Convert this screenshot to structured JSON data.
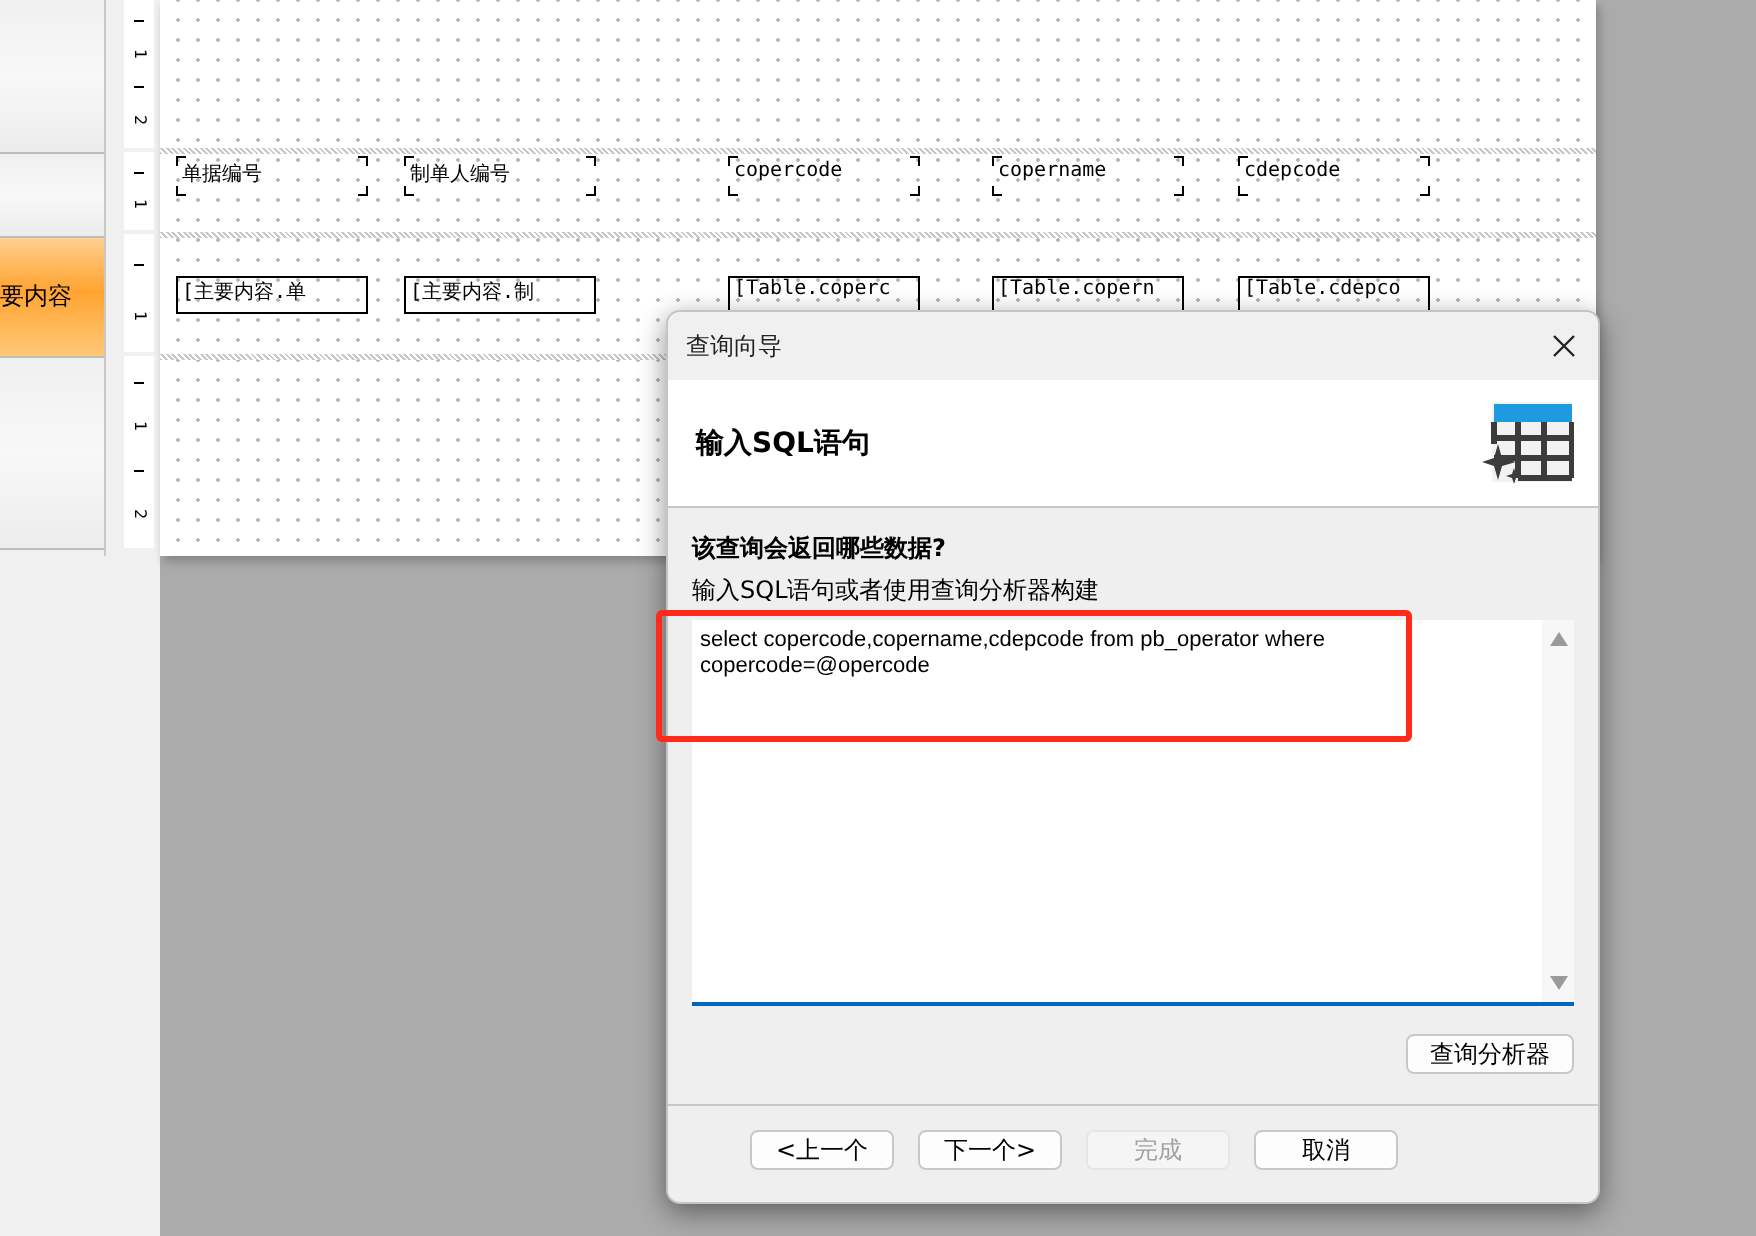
{
  "sidebar": {
    "items": [
      {
        "selected": false
      },
      {
        "selected": false
      },
      {
        "label": "要内容",
        "selected": true
      },
      {
        "selected": false
      }
    ]
  },
  "ruler": {
    "bands": [
      [
        "1",
        "2"
      ],
      [
        "1"
      ],
      [
        "1"
      ],
      [
        "1",
        "2"
      ]
    ]
  },
  "report": {
    "header_fields": [
      {
        "text": "单据编号",
        "kind": "label"
      },
      {
        "text": "制单人编号",
        "kind": "label"
      },
      {
        "text": "copercode",
        "kind": "label"
      },
      {
        "text": "copername",
        "kind": "label"
      },
      {
        "text": "cdepcode",
        "kind": "label"
      }
    ],
    "detail_fields": [
      {
        "text": "[主要内容.单",
        "kind": "data"
      },
      {
        "text": "[主要内容.制",
        "kind": "data"
      },
      {
        "text": "[Table.coperc",
        "kind": "data"
      },
      {
        "text": "[Table.copern",
        "kind": "data"
      },
      {
        "text": "[Table.cdepco",
        "kind": "data"
      }
    ]
  },
  "dialog": {
    "title": "查询向导",
    "heading": "输入SQL语句",
    "question": "该查询会返回哪些数据?",
    "hint": "输入SQL语句或者使用查询分析器构建",
    "sql": "select copercode,copername,cdepcode from pb_operator where copercode=@opercode",
    "builder_button": "查询分析器",
    "buttons": [
      {
        "label": "<上一个",
        "disabled": false
      },
      {
        "label": "下一个>",
        "disabled": false
      },
      {
        "label": "完成",
        "disabled": true
      },
      {
        "label": "取消",
        "disabled": false
      }
    ]
  },
  "annotation": {
    "kind": "highlight"
  }
}
